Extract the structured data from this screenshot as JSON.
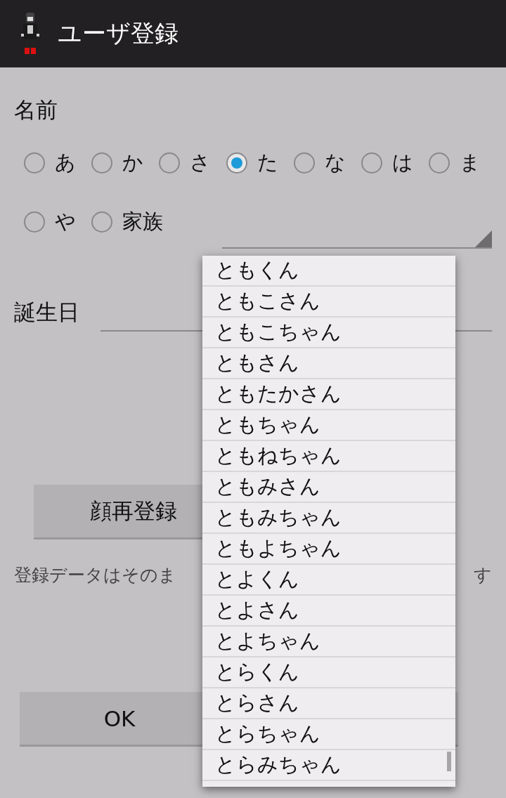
{
  "app_bar": {
    "title": "ユーザ登録"
  },
  "name_label": "名前",
  "name_radios": [
    {
      "label": "あ",
      "selected": false
    },
    {
      "label": "か",
      "selected": false
    },
    {
      "label": "さ",
      "selected": false
    },
    {
      "label": "た",
      "selected": true
    },
    {
      "label": "な",
      "selected": false
    },
    {
      "label": "は",
      "selected": false
    },
    {
      "label": "ま",
      "selected": false
    },
    {
      "label": "や",
      "selected": false
    },
    {
      "label": "家族",
      "selected": false
    }
  ],
  "birthday_label": "誕生日",
  "face_button": "顔再登録",
  "note": [
    "登録データはそのま",
    "す"
  ],
  "ok_button": "OK",
  "dropdown": {
    "items": [
      "ともくん",
      "ともこさん",
      "ともこちゃん",
      "ともさん",
      "ともたかさん",
      "ともちゃん",
      "ともねちゃん",
      "ともみさん",
      "ともみちゃん",
      "ともよちゃん",
      "とよくん",
      "とよさん",
      "とよちゃん",
      "とらくん",
      "とらさん",
      "とらちゃん",
      "とらみちゃん"
    ]
  }
}
